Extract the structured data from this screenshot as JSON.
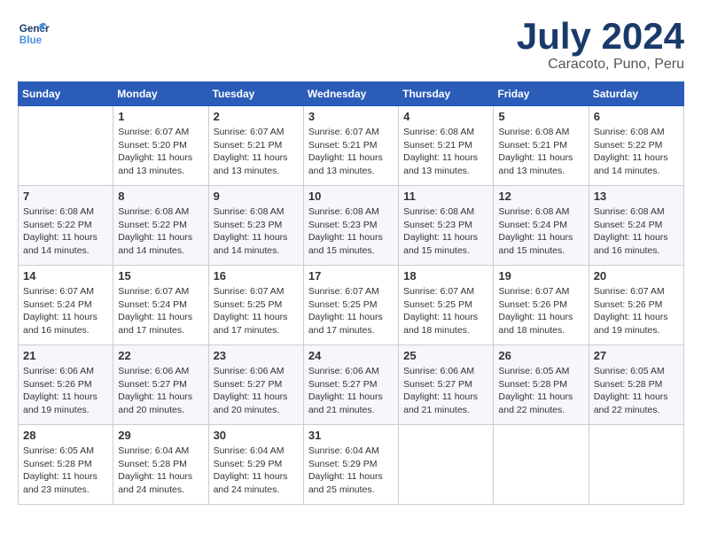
{
  "header": {
    "logo_line1": "General",
    "logo_line2": "Blue",
    "month": "July 2024",
    "location": "Caracoto, Puno, Peru"
  },
  "weekdays": [
    "Sunday",
    "Monday",
    "Tuesday",
    "Wednesday",
    "Thursday",
    "Friday",
    "Saturday"
  ],
  "weeks": [
    [
      {
        "num": "",
        "info": ""
      },
      {
        "num": "1",
        "info": "Sunrise: 6:07 AM\nSunset: 5:20 PM\nDaylight: 11 hours\nand 13 minutes."
      },
      {
        "num": "2",
        "info": "Sunrise: 6:07 AM\nSunset: 5:21 PM\nDaylight: 11 hours\nand 13 minutes."
      },
      {
        "num": "3",
        "info": "Sunrise: 6:07 AM\nSunset: 5:21 PM\nDaylight: 11 hours\nand 13 minutes."
      },
      {
        "num": "4",
        "info": "Sunrise: 6:08 AM\nSunset: 5:21 PM\nDaylight: 11 hours\nand 13 minutes."
      },
      {
        "num": "5",
        "info": "Sunrise: 6:08 AM\nSunset: 5:21 PM\nDaylight: 11 hours\nand 13 minutes."
      },
      {
        "num": "6",
        "info": "Sunrise: 6:08 AM\nSunset: 5:22 PM\nDaylight: 11 hours\nand 14 minutes."
      }
    ],
    [
      {
        "num": "7",
        "info": "Sunrise: 6:08 AM\nSunset: 5:22 PM\nDaylight: 11 hours\nand 14 minutes."
      },
      {
        "num": "8",
        "info": "Sunrise: 6:08 AM\nSunset: 5:22 PM\nDaylight: 11 hours\nand 14 minutes."
      },
      {
        "num": "9",
        "info": "Sunrise: 6:08 AM\nSunset: 5:23 PM\nDaylight: 11 hours\nand 14 minutes."
      },
      {
        "num": "10",
        "info": "Sunrise: 6:08 AM\nSunset: 5:23 PM\nDaylight: 11 hours\nand 15 minutes."
      },
      {
        "num": "11",
        "info": "Sunrise: 6:08 AM\nSunset: 5:23 PM\nDaylight: 11 hours\nand 15 minutes."
      },
      {
        "num": "12",
        "info": "Sunrise: 6:08 AM\nSunset: 5:24 PM\nDaylight: 11 hours\nand 15 minutes."
      },
      {
        "num": "13",
        "info": "Sunrise: 6:08 AM\nSunset: 5:24 PM\nDaylight: 11 hours\nand 16 minutes."
      }
    ],
    [
      {
        "num": "14",
        "info": "Sunrise: 6:07 AM\nSunset: 5:24 PM\nDaylight: 11 hours\nand 16 minutes."
      },
      {
        "num": "15",
        "info": "Sunrise: 6:07 AM\nSunset: 5:24 PM\nDaylight: 11 hours\nand 17 minutes."
      },
      {
        "num": "16",
        "info": "Sunrise: 6:07 AM\nSunset: 5:25 PM\nDaylight: 11 hours\nand 17 minutes."
      },
      {
        "num": "17",
        "info": "Sunrise: 6:07 AM\nSunset: 5:25 PM\nDaylight: 11 hours\nand 17 minutes."
      },
      {
        "num": "18",
        "info": "Sunrise: 6:07 AM\nSunset: 5:25 PM\nDaylight: 11 hours\nand 18 minutes."
      },
      {
        "num": "19",
        "info": "Sunrise: 6:07 AM\nSunset: 5:26 PM\nDaylight: 11 hours\nand 18 minutes."
      },
      {
        "num": "20",
        "info": "Sunrise: 6:07 AM\nSunset: 5:26 PM\nDaylight: 11 hours\nand 19 minutes."
      }
    ],
    [
      {
        "num": "21",
        "info": "Sunrise: 6:06 AM\nSunset: 5:26 PM\nDaylight: 11 hours\nand 19 minutes."
      },
      {
        "num": "22",
        "info": "Sunrise: 6:06 AM\nSunset: 5:27 PM\nDaylight: 11 hours\nand 20 minutes."
      },
      {
        "num": "23",
        "info": "Sunrise: 6:06 AM\nSunset: 5:27 PM\nDaylight: 11 hours\nand 20 minutes."
      },
      {
        "num": "24",
        "info": "Sunrise: 6:06 AM\nSunset: 5:27 PM\nDaylight: 11 hours\nand 21 minutes."
      },
      {
        "num": "25",
        "info": "Sunrise: 6:06 AM\nSunset: 5:27 PM\nDaylight: 11 hours\nand 21 minutes."
      },
      {
        "num": "26",
        "info": "Sunrise: 6:05 AM\nSunset: 5:28 PM\nDaylight: 11 hours\nand 22 minutes."
      },
      {
        "num": "27",
        "info": "Sunrise: 6:05 AM\nSunset: 5:28 PM\nDaylight: 11 hours\nand 22 minutes."
      }
    ],
    [
      {
        "num": "28",
        "info": "Sunrise: 6:05 AM\nSunset: 5:28 PM\nDaylight: 11 hours\nand 23 minutes."
      },
      {
        "num": "29",
        "info": "Sunrise: 6:04 AM\nSunset: 5:28 PM\nDaylight: 11 hours\nand 24 minutes."
      },
      {
        "num": "30",
        "info": "Sunrise: 6:04 AM\nSunset: 5:29 PM\nDaylight: 11 hours\nand 24 minutes."
      },
      {
        "num": "31",
        "info": "Sunrise: 6:04 AM\nSunset: 5:29 PM\nDaylight: 11 hours\nand 25 minutes."
      },
      {
        "num": "",
        "info": ""
      },
      {
        "num": "",
        "info": ""
      },
      {
        "num": "",
        "info": ""
      }
    ]
  ]
}
